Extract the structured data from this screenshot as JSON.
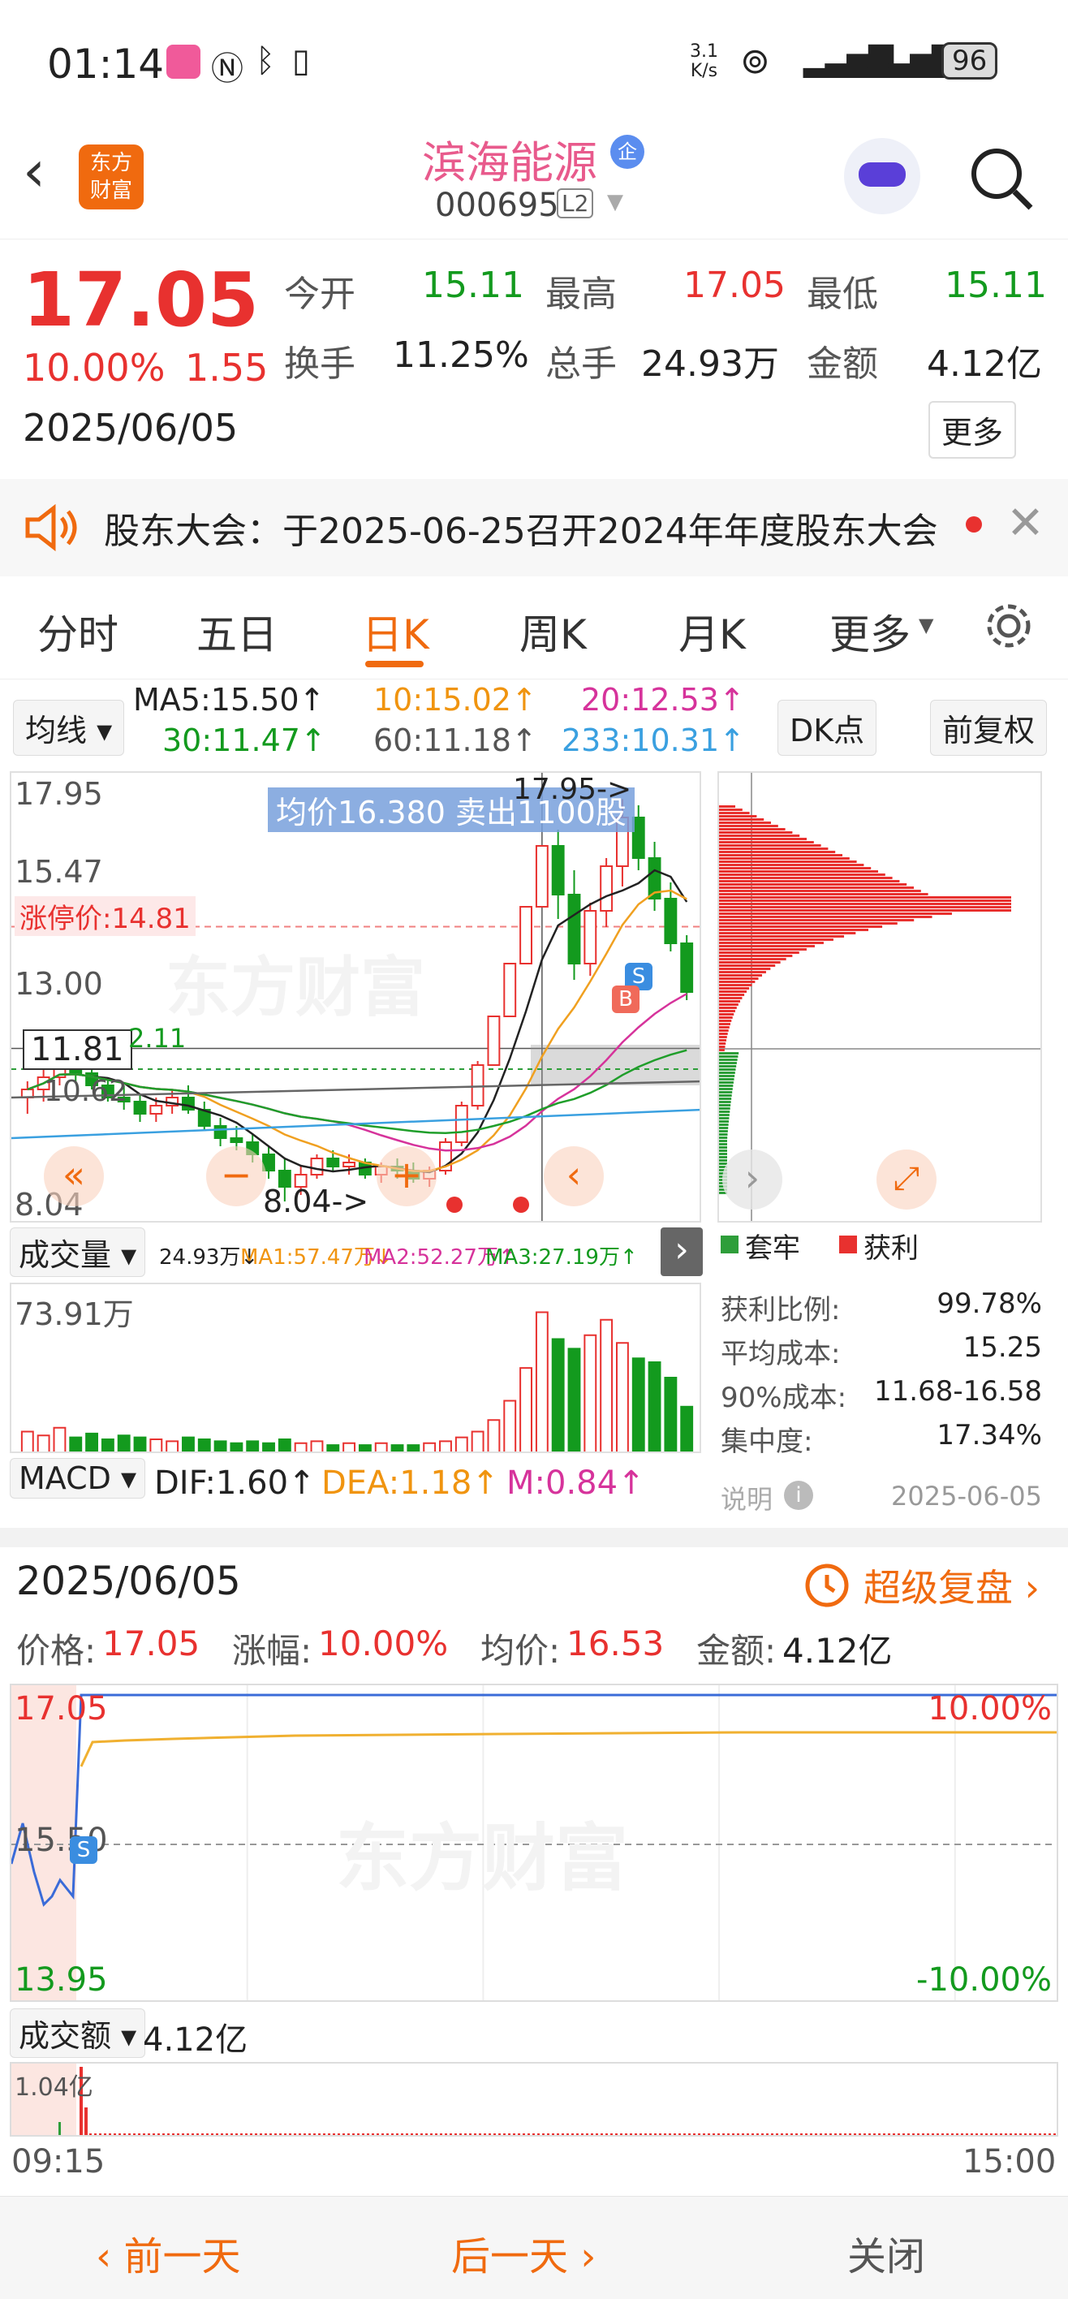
{
  "status": {
    "time": "01:14",
    "speed_top": "3.1",
    "speed_bottom": "K/s",
    "battery": "96"
  },
  "header": {
    "title": "滨海能源",
    "code": "000695",
    "level_badge": "L2",
    "logo_top": "东方",
    "logo_bottom": "财富",
    "enterprise_badge": "企"
  },
  "quote": {
    "price": "17.05",
    "change_pct": "10.00%",
    "change_amt": "1.55",
    "date": "2025/06/05",
    "open_label": "今开",
    "open": "15.11",
    "high_label": "最高",
    "high": "17.05",
    "low_label": "最低",
    "low": "15.11",
    "turnover_label": "换手",
    "turnover": "11.25%",
    "volume_label": "总手",
    "volume": "24.93万",
    "amount_label": "金额",
    "amount": "4.12亿",
    "more_label": "更多"
  },
  "notice": {
    "text": "股东大会：于2025-06-25召开2024年年度股东大会"
  },
  "tabs": [
    "分时",
    "五日",
    "日K",
    "周K",
    "月K",
    "更多"
  ],
  "active_tab": "日K",
  "kline": {
    "ma_selector": "均线",
    "ma5": "MA5:15.50↑",
    "ma10": "10:15.02↑",
    "ma20": "20:12.53↑",
    "ma30": "30:11.47↑",
    "ma60": "60:11.18↑",
    "ma233": "233:10.31↑",
    "dk_button": "DK点",
    "adjust_button": "前复权",
    "y_labels": [
      "17.95",
      "15.47",
      "13.00",
      "8.04"
    ],
    "limit_up": "涨停价:14.81",
    "crosshair_price": "11.81",
    "crosshair_value": "2.11",
    "left_label": "10.62",
    "tooltip": "均价16.380  卖出1100股",
    "high_marker": "17.95->",
    "low_marker": "8.04->",
    "watermark": "东方财富",
    "badge_s": "S",
    "badge_b": "B"
  },
  "volume": {
    "selector": "成交量",
    "value": "24.93万↓",
    "ma1": "MA1:57.47万↓",
    "ma2": "MA2:52.27万↑",
    "ma3": "MA3:27.19万↑",
    "max_label": "73.91万"
  },
  "macd": {
    "selector": "MACD",
    "dif": "DIF:1.60↑",
    "dea": "DEA:1.18↑",
    "m": "M:0.84↑"
  },
  "chips": {
    "legend_trap": "套牢",
    "legend_profit": "获利",
    "rows": [
      {
        "label": "获利比例:",
        "value": "99.78%"
      },
      {
        "label": "平均成本:",
        "value": "15.25"
      },
      {
        "label": "90%成本:",
        "value": "11.68-16.58"
      },
      {
        "label": "集中度:",
        "value": "17.34%"
      }
    ],
    "note_label": "说明",
    "note_date": "2025-06-05"
  },
  "detail": {
    "date": "2025/06/05",
    "replay": "超级复盘",
    "price_label": "价格:",
    "price": "17.05",
    "chg_label": "涨幅:",
    "chg": "10.00%",
    "avg_label": "均价:",
    "avg": "16.53",
    "amt_label": "金额:",
    "amt": "4.12亿",
    "top_price": "17.05",
    "mid_price": "15.50",
    "bottom_price": "13.95",
    "top_pct": "10.00%",
    "bottom_pct": "-10.00%",
    "watermark": "东方财富",
    "turnover_selector": "成交额",
    "turnover_value": "4.12亿",
    "turnover_max": "1.04亿",
    "time_start": "09:15",
    "time_end": "15:00"
  },
  "bottom": {
    "prev": "前一天",
    "next": "后一天",
    "close": "关闭"
  },
  "colors": {
    "up": "#e8312f",
    "down": "#139a1e",
    "accent": "#f06a0f",
    "ma5": "#222222",
    "ma10": "#f0a020",
    "ma20": "#d6339b",
    "ma30": "#1f9e2a",
    "ma60": "#666666",
    "ma233": "#3aa0e0"
  },
  "chart_data": {
    "type": "table",
    "kline_candles": [
      {
        "o": 10.6,
        "h": 11.0,
        "l": 10.2,
        "c": 10.8
      },
      {
        "o": 10.8,
        "h": 11.3,
        "l": 10.5,
        "c": 11.1
      },
      {
        "o": 11.1,
        "h": 11.9,
        "l": 10.9,
        "c": 11.6
      },
      {
        "o": 11.6,
        "h": 11.8,
        "l": 11.0,
        "c": 11.2
      },
      {
        "o": 11.2,
        "h": 11.4,
        "l": 10.8,
        "c": 10.9
      },
      {
        "o": 10.9,
        "h": 11.1,
        "l": 10.5,
        "c": 10.6
      },
      {
        "o": 10.6,
        "h": 10.9,
        "l": 10.3,
        "c": 10.5
      },
      {
        "o": 10.5,
        "h": 10.7,
        "l": 10.0,
        "c": 10.2
      },
      {
        "o": 10.2,
        "h": 10.6,
        "l": 10.0,
        "c": 10.4
      },
      {
        "o": 10.4,
        "h": 10.8,
        "l": 10.2,
        "c": 10.6
      },
      {
        "o": 10.6,
        "h": 10.9,
        "l": 10.2,
        "c": 10.3
      },
      {
        "o": 10.3,
        "h": 10.5,
        "l": 9.8,
        "c": 9.9
      },
      {
        "o": 9.9,
        "h": 10.1,
        "l": 9.4,
        "c": 9.6
      },
      {
        "o": 9.6,
        "h": 9.9,
        "l": 9.3,
        "c": 9.5
      },
      {
        "o": 9.5,
        "h": 9.7,
        "l": 9.0,
        "c": 9.2
      },
      {
        "o": 9.2,
        "h": 9.4,
        "l": 8.6,
        "c": 8.8
      },
      {
        "o": 8.8,
        "h": 9.1,
        "l": 8.04,
        "c": 8.4
      },
      {
        "o": 8.4,
        "h": 8.9,
        "l": 8.2,
        "c": 8.7
      },
      {
        "o": 8.7,
        "h": 9.2,
        "l": 8.6,
        "c": 9.1
      },
      {
        "o": 9.1,
        "h": 9.3,
        "l": 8.8,
        "c": 8.9
      },
      {
        "o": 8.9,
        "h": 9.2,
        "l": 8.7,
        "c": 9.0
      },
      {
        "o": 9.0,
        "h": 9.1,
        "l": 8.6,
        "c": 8.7
      },
      {
        "o": 8.7,
        "h": 9.0,
        "l": 8.5,
        "c": 8.9
      },
      {
        "o": 8.9,
        "h": 9.1,
        "l": 8.6,
        "c": 8.8
      },
      {
        "o": 8.8,
        "h": 9.0,
        "l": 8.5,
        "c": 8.6
      },
      {
        "o": 8.6,
        "h": 8.9,
        "l": 8.4,
        "c": 8.8
      },
      {
        "o": 8.8,
        "h": 9.6,
        "l": 8.7,
        "c": 9.5
      },
      {
        "o": 9.5,
        "h": 10.5,
        "l": 9.4,
        "c": 10.4
      },
      {
        "o": 10.4,
        "h": 11.5,
        "l": 10.3,
        "c": 11.4
      },
      {
        "o": 11.4,
        "h": 12.6,
        "l": 11.4,
        "c": 12.6
      },
      {
        "o": 12.6,
        "h": 13.9,
        "l": 12.6,
        "c": 13.9
      },
      {
        "o": 13.9,
        "h": 15.3,
        "l": 13.9,
        "c": 15.3
      },
      {
        "o": 15.3,
        "h": 16.8,
        "l": 15.3,
        "c": 16.8
      },
      {
        "o": 16.8,
        "h": 17.2,
        "l": 15.0,
        "c": 15.6
      },
      {
        "o": 15.6,
        "h": 16.2,
        "l": 13.5,
        "c": 13.9
      },
      {
        "o": 13.9,
        "h": 15.4,
        "l": 13.6,
        "c": 15.2
      },
      {
        "o": 15.2,
        "h": 16.5,
        "l": 14.8,
        "c": 16.3
      },
      {
        "o": 16.3,
        "h": 17.95,
        "l": 15.8,
        "c": 17.5
      },
      {
        "o": 17.5,
        "h": 17.8,
        "l": 16.2,
        "c": 16.5
      },
      {
        "o": 16.5,
        "h": 16.9,
        "l": 15.2,
        "c": 15.5
      },
      {
        "o": 15.5,
        "h": 15.9,
        "l": 14.2,
        "c": 14.4
      },
      {
        "o": 14.4,
        "h": 14.6,
        "l": 13.0,
        "c": 13.2
      }
    ],
    "volume_bars": [
      12,
      10,
      14,
      9,
      11,
      8,
      10,
      9,
      8,
      7,
      9,
      8,
      7,
      6,
      7,
      6,
      8,
      6,
      7,
      5,
      6,
      5,
      6,
      5,
      5,
      6,
      7,
      9,
      12,
      18,
      28,
      45,
      73.91,
      60,
      55,
      62,
      70,
      58,
      50,
      48,
      40,
      24.93
    ],
    "chip_profit_ratio": "99.78%",
    "intraday_price_range": [
      13.95,
      17.05
    ]
  }
}
